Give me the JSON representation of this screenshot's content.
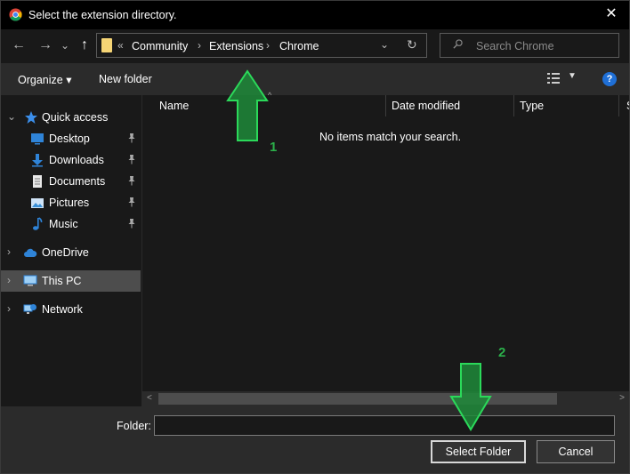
{
  "window": {
    "title": "Select the extension directory."
  },
  "address_bar": {
    "overflow": "«",
    "crumbs": [
      "Community",
      "Extensions",
      "Chrome"
    ]
  },
  "search": {
    "placeholder": "Search Chrome"
  },
  "toolbar": {
    "organize_label": "Organize ▾",
    "new_folder_label": "New folder",
    "help": "?"
  },
  "sidebar": {
    "quick_access": "Quick access",
    "items": [
      {
        "label": "Desktop",
        "icon": "desktop-icon",
        "pinned": true
      },
      {
        "label": "Downloads",
        "icon": "downloads-icon",
        "pinned": true
      },
      {
        "label": "Documents",
        "icon": "documents-icon",
        "pinned": true
      },
      {
        "label": "Pictures",
        "icon": "pictures-icon",
        "pinned": true
      },
      {
        "label": "Music",
        "icon": "music-icon",
        "pinned": true
      }
    ],
    "onedrive": "OneDrive",
    "this_pc": "This PC",
    "network": "Network"
  },
  "file_list": {
    "columns": [
      "Name",
      "Date modified",
      "Type",
      "S"
    ],
    "empty_message": "No items match your search."
  },
  "footer": {
    "folder_label": "Folder:",
    "folder_value": "",
    "select_button": "Select Folder",
    "cancel_button": "Cancel"
  },
  "annotations": {
    "step1": "1",
    "step2": "2"
  },
  "colors": {
    "accent_green": "#2bb04a",
    "help_blue": "#1f6fd6",
    "selected_bg": "#4d4d4d"
  }
}
